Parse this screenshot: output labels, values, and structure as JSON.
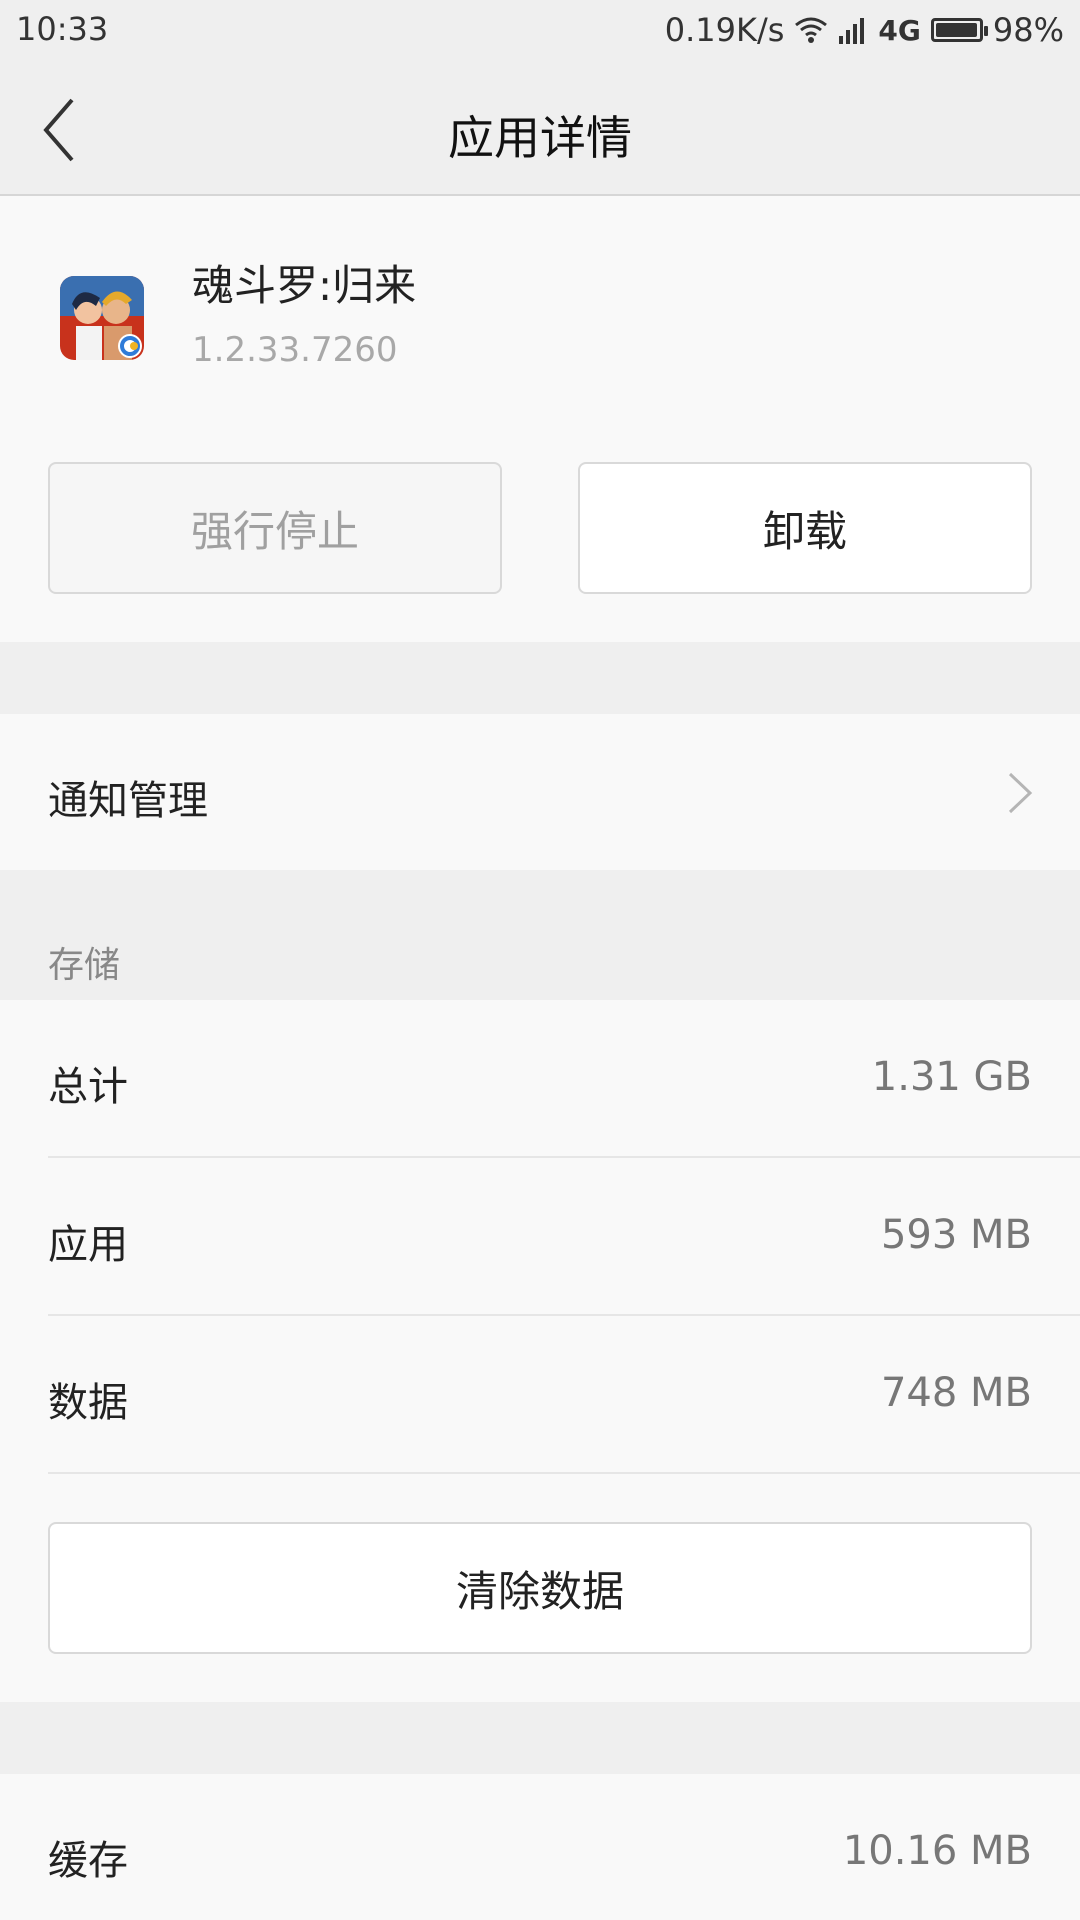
{
  "status_bar": {
    "time": "10:33",
    "net_speed": "0.19K/s",
    "network": "4G",
    "battery": "98%",
    "battery_level": 0.98
  },
  "header": {
    "title": "应用详情",
    "back_icon": "back-chevron-icon"
  },
  "app": {
    "name": "魂斗罗:归来",
    "version": "1.2.33.7260",
    "icon": "game-app-icon"
  },
  "actions": {
    "force_stop": "强行停止",
    "uninstall": "卸载"
  },
  "notification": {
    "label": "通知管理"
  },
  "storage": {
    "section_label": "存储",
    "rows": [
      {
        "label": "总计",
        "value": "1.31 GB"
      },
      {
        "label": "应用",
        "value": "593 MB"
      },
      {
        "label": "数据",
        "value": "748 MB"
      }
    ],
    "clear_data": "清除数据"
  },
  "cache": {
    "label": "缓存",
    "value": "10.16 MB"
  },
  "colors": {
    "page_bg": "#f9f9f9",
    "section_bg": "#efefef",
    "muted_text": "#a0a0a0"
  }
}
